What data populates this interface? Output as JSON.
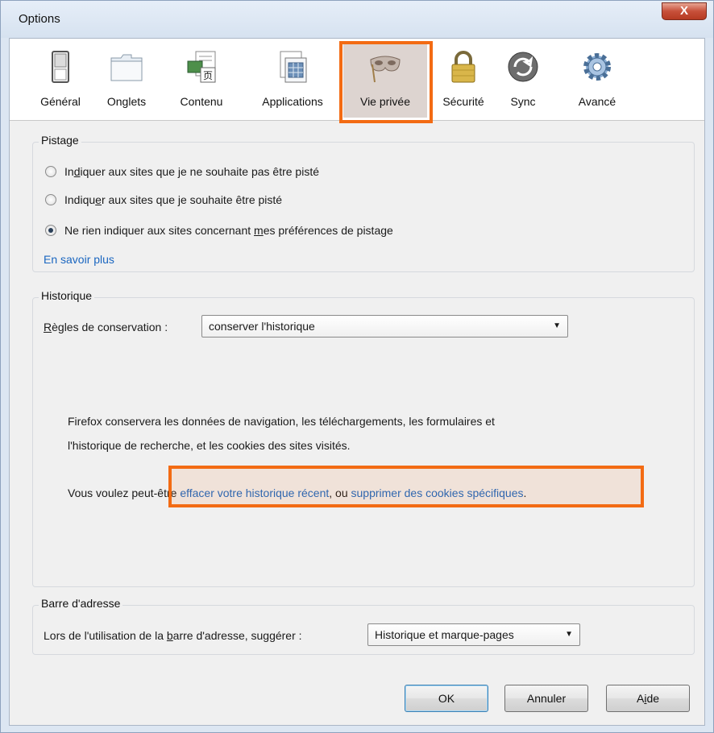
{
  "window": {
    "title": "Options",
    "close_label": "X"
  },
  "toolbar": {
    "panes": [
      {
        "label": "Général",
        "icon": "switch-icon"
      },
      {
        "label": "Onglets",
        "icon": "folder-tabs-icon"
      },
      {
        "label": "Contenu",
        "icon": "content-page-icon"
      },
      {
        "label": "Applications",
        "icon": "applications-icon"
      },
      {
        "label": "Vie privée",
        "icon": "privacy-mask-icon",
        "selected": true
      },
      {
        "label": "Sécurité",
        "icon": "padlock-icon"
      },
      {
        "label": "Sync",
        "icon": "sync-arrows-icon"
      },
      {
        "label": "Avancé",
        "icon": "gear-icon"
      }
    ]
  },
  "tracking": {
    "title": "Pistage",
    "options": [
      {
        "pre": "In",
        "key": "d",
        "post": "iquer aux sites que je ne souhaite pas être pisté",
        "checked": false
      },
      {
        "pre": "Indiqu",
        "key": "e",
        "post": "r aux sites que je souhaite être pisté",
        "checked": false
      },
      {
        "pre": "Ne rien indiquer aux sites concernant ",
        "key": "m",
        "post": "es préférences de pistage",
        "checked": true
      }
    ],
    "learn_more": "En savoir plus"
  },
  "history": {
    "title": "Historique",
    "rules_label_key": "R",
    "rules_label_rest": "ègles de conservation :",
    "rules_value": "conserver l'historique",
    "desc_line1": "Firefox conservera les données de navigation, les téléchargements, les formulaires et",
    "desc_line2": "l'historique de recherche, et les cookies des sites visités.",
    "maybe_prefix": "Vous voulez peut-être ",
    "clear_link": "effacer votre historique récent",
    "or_text": ", ou ",
    "cookies_link": "supprimer des cookies spécifiques",
    "end_text": "."
  },
  "addressbar": {
    "title": "Barre d'adresse",
    "label_pre": "Lors de l'utilisation de la ",
    "label_key": "b",
    "label_post": "arre d'adresse, suggérer :",
    "suggest_value": "Historique et marque-pages"
  },
  "buttons": {
    "ok": "OK",
    "cancel": "Annuler",
    "help_pre": "A",
    "help_key": "i",
    "help_post": "de"
  },
  "colors": {
    "highlight": "#f36b13",
    "link": "#1a66c0"
  }
}
